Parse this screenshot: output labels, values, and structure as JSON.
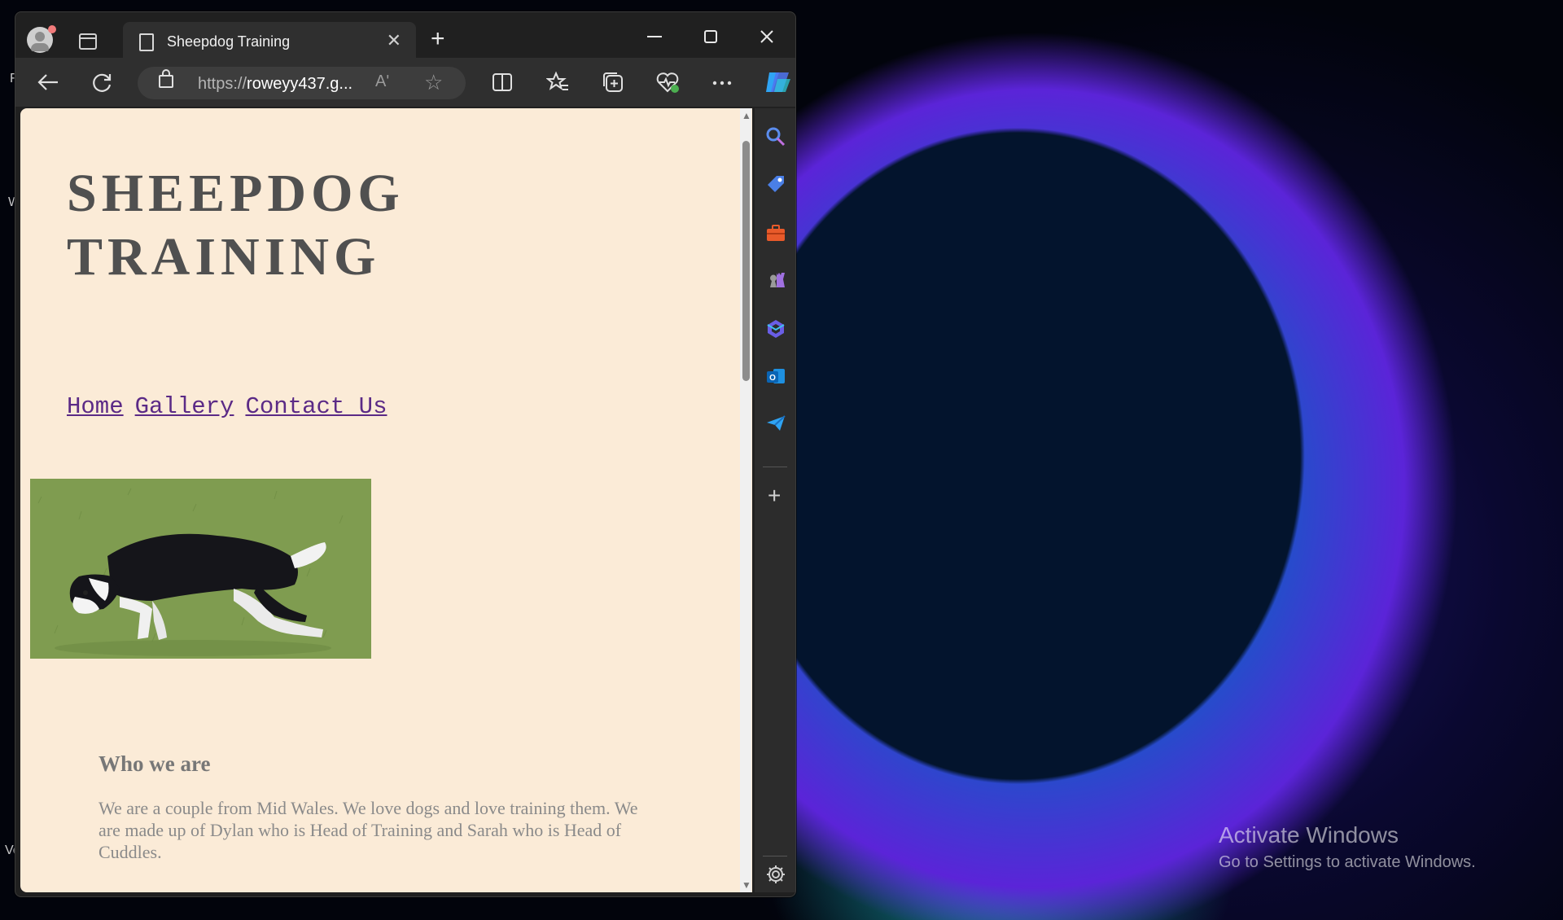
{
  "desktop": {
    "watermark_line1": "Activate Windows",
    "watermark_line2": "Go to Settings to activate Windows.",
    "edge_letters": [
      "F",
      "W",
      "Ve"
    ]
  },
  "browser": {
    "tab_title": "Sheepdog Training",
    "url_prefix": "https://",
    "url_host": "roweyy437.g...",
    "read_aloud_label": "Aʹ",
    "icons": {
      "back": "back-arrow-icon",
      "refresh": "refresh-icon",
      "lock": "lock-icon",
      "read_aloud": "read-aloud-icon",
      "favorite": "star-icon",
      "split": "split-screen-icon",
      "favorites": "favorites-icon",
      "collections": "collections-icon",
      "health": "browser-essentials-icon",
      "more": "more-icon",
      "copilot": "copilot-icon"
    }
  },
  "page": {
    "site_title": "SHEEPDOG TRAINING",
    "nav": [
      "Home",
      "Gallery",
      "Contact Us"
    ],
    "about_heading": "Who we are",
    "about_text": "We are a couple from Mid Wales. We love dogs and love training them. We are made up of Dylan who is Head of Training and Sarah who is Head of Cuddles."
  },
  "sidebar": {
    "items": [
      "search-icon",
      "shopping-tag-icon",
      "tools-icon",
      "games-icon",
      "microsoft-365-icon",
      "outlook-icon",
      "send-icon"
    ],
    "add_label": "+",
    "settings": "settings-gear-icon"
  },
  "colors": {
    "page_bg": "#fbebd7",
    "title_color": "#505050",
    "link_color": "#5b2a86",
    "frame": "#202020"
  }
}
